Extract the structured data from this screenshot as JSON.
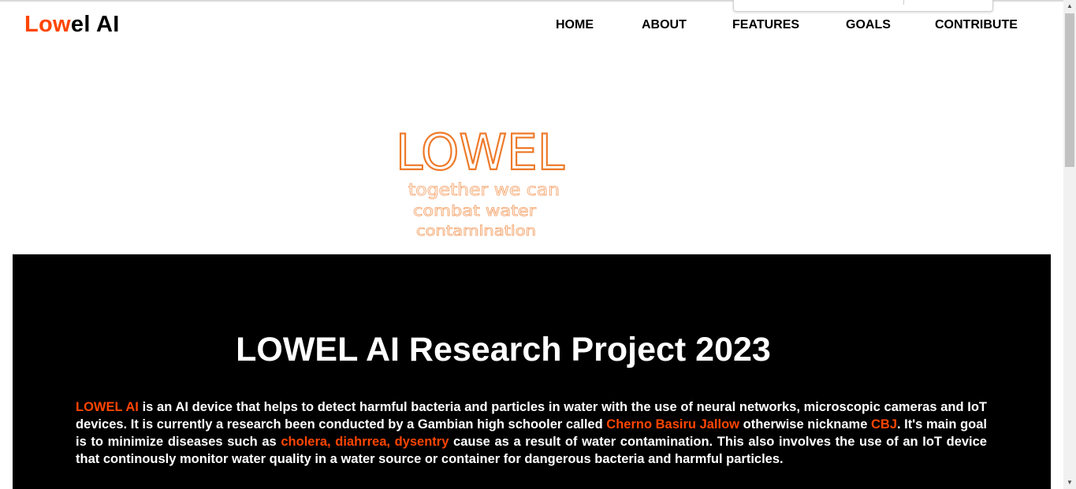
{
  "header": {
    "logo_accent": "Low",
    "logo_rest": "el AI",
    "nav": [
      "HOME",
      "ABOUT",
      "FEATURES",
      "GOALS",
      "CONTRIBUTE"
    ]
  },
  "hero": {
    "title": "LOWEL",
    "line1": "together we can",
    "line2": "combat water",
    "line3": "contamination"
  },
  "main": {
    "heading": "LOWEL AI Research Project 2023",
    "p_highlight1": "LOWEL AI",
    "p_text1": " is an AI device that helps to detect harmful bacteria and particles in water with the use of neural networks, microscopic cameras and IoT devices. It is currently a research been conducted by a Gambian high schooler called ",
    "p_highlight2": "Cherno Basiru Jallow",
    "p_text2": " otherwise nickname ",
    "p_highlight3": "CBJ",
    "p_text3": ". It's main goal is to minimize diseases such as ",
    "p_highlight4": "cholera, diahrrea, dysentry",
    "p_text4": " cause as a result of water contamination. This also involves the use of an IoT device that continously monitor water quality in a water source or container for dangerous bacteria and harmful particles."
  },
  "colors": {
    "accent": "#ff4500",
    "dark_bg": "#000000",
    "hero_ink": "#ee7a2a"
  },
  "icons": {
    "scroll_up": "triangle-up-icon",
    "scroll_down": "triangle-down-icon"
  }
}
